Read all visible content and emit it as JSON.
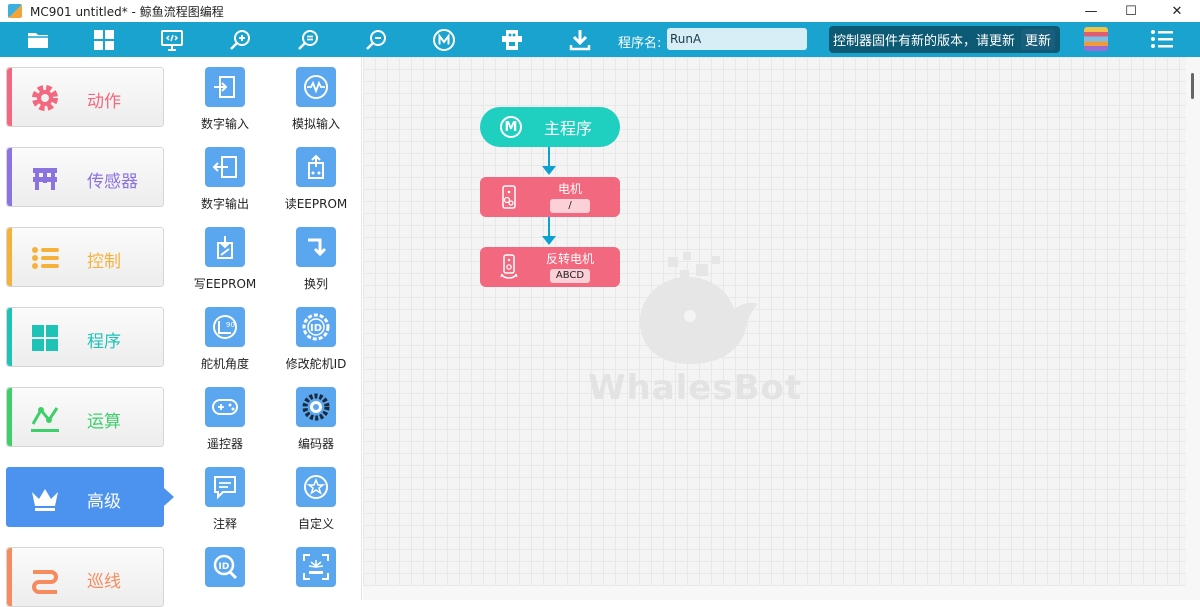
{
  "window": {
    "title": "MC901 untitled* - 鲸鱼流程图编程"
  },
  "toolbar": {
    "program_name_label": "程序名:",
    "program_name_value": "RunA",
    "update_notice": "控制器固件有新的版本，请更新",
    "update_button": "更新"
  },
  "categories": [
    {
      "label": "动作",
      "color": "#f2687e"
    },
    {
      "label": "传感器",
      "color": "#8b73e0"
    },
    {
      "label": "控制",
      "color": "#f5b23b"
    },
    {
      "label": "程序",
      "color": "#1fc3b6"
    },
    {
      "label": "运算",
      "color": "#3ecf6a"
    },
    {
      "label": "高级",
      "color": "#4b93ee"
    },
    {
      "label": "巡线",
      "color": "#f58b5e"
    }
  ],
  "blocks": [
    {
      "label": "数字输入",
      "icon": "digital-input-icon"
    },
    {
      "label": "模拟输入",
      "icon": "analog-input-icon"
    },
    {
      "label": "数字输出",
      "icon": "digital-output-icon"
    },
    {
      "label": "读EEPROM",
      "icon": "read-eeprom-icon"
    },
    {
      "label": "写EEPROM",
      "icon": "write-eeprom-icon"
    },
    {
      "label": "换列",
      "icon": "turn-arrow-icon"
    },
    {
      "label": "舵机角度",
      "icon": "servo-angle-icon"
    },
    {
      "label": "修改舵机ID",
      "icon": "servo-id-icon"
    },
    {
      "label": "遥控器",
      "icon": "gamepad-icon"
    },
    {
      "label": "编码器",
      "icon": "encoder-icon"
    },
    {
      "label": "注释",
      "icon": "comment-icon"
    },
    {
      "label": "自定义",
      "icon": "star-icon"
    },
    {
      "label": "",
      "icon": "id-search-icon"
    },
    {
      "label": "",
      "icon": "scan-icon"
    }
  ],
  "flow": {
    "main": "主程序",
    "main_icon_letter": "M",
    "node1": {
      "title": "电机",
      "value": "/"
    },
    "node2": {
      "title": "反转电机",
      "value": "ABCD"
    }
  },
  "watermark": "WhalesBot"
}
